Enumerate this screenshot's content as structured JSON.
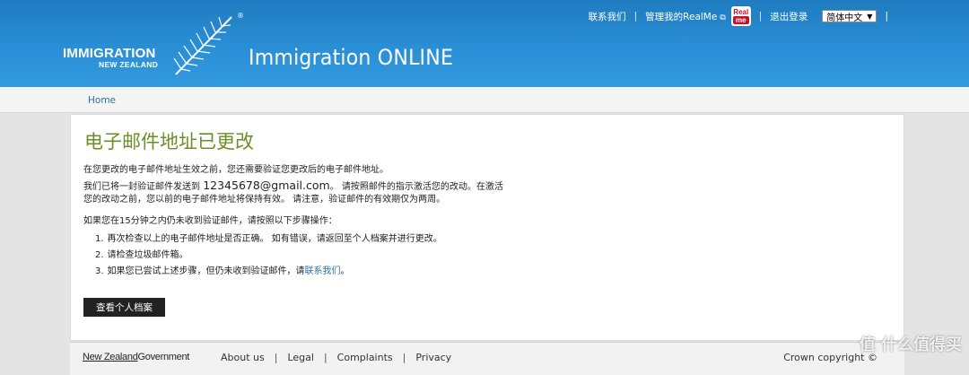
{
  "header": {
    "logo_line1": "IMMIGRATION",
    "logo_line2": "NEW ZEALAND",
    "registered": "®",
    "site_title": "Immigration ONLINE",
    "nav": {
      "contact": "联系我们",
      "manage_realme": "管理我的RealMe",
      "realme_badge_top": "Real",
      "realme_badge_bottom": "me",
      "logout": "退出登录",
      "language": "简体中文",
      "separator": "|"
    }
  },
  "breadcrumb": {
    "home": "Home"
  },
  "main": {
    "title": "电子邮件地址已更改",
    "para1": "在您更改的电子邮件地址生效之前，您还需要验证您更改后的电子邮件地址。",
    "para2_prefix": "我们已将一封验证邮件发送到",
    "email": "12345678@gmail.com",
    "para2_suffix": "。 请按照邮件的指示激活您的改动。在激活您的改动之前，您以前的电子邮件地址将保持有效。 请注意，验证邮件的有效期仅为两周。",
    "para3": "如果您在15分钟之内仍未收到验证邮件，请按照以下步骤操作：",
    "steps": [
      {
        "num": "1.",
        "text": "再次检查以上的电子邮件地址是否正确。 如有错误，请返回至个人档案并进行更改。"
      },
      {
        "num": "2.",
        "text": "请检查垃圾邮件箱。"
      },
      {
        "num": "3.",
        "text": "如果您已尝试上述步骤，但仍未收到验证邮件，请",
        "link": "联系我们",
        "end": "。"
      }
    ],
    "button": "查看个人档案"
  },
  "footer": {
    "govt_a": "New Zealand",
    "govt_b": "Government",
    "links": [
      "About us",
      "Legal",
      "Complaints",
      "Privacy"
    ],
    "separator": "|",
    "copyright": "Crown copyright ©"
  },
  "watermark": "值 什么值得买",
  "colors": {
    "header_blue": "#2a8fd6",
    "title_green": "#6b8f26",
    "link_blue": "#2e6fa7"
  }
}
